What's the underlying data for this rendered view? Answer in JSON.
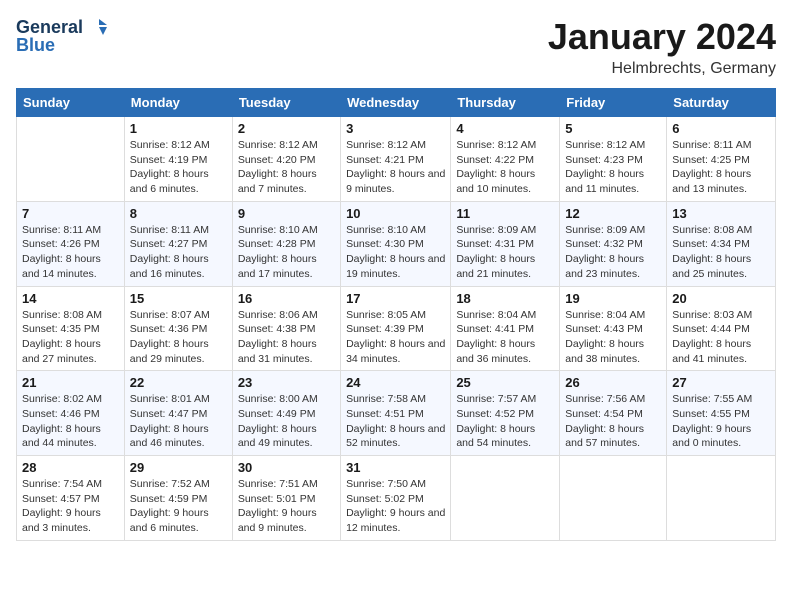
{
  "header": {
    "logo_line1": "General",
    "logo_line2": "Blue",
    "month": "January 2024",
    "location": "Helmbrechts, Germany"
  },
  "weekdays": [
    "Sunday",
    "Monday",
    "Tuesday",
    "Wednesday",
    "Thursday",
    "Friday",
    "Saturday"
  ],
  "weeks": [
    [
      {
        "day": "",
        "sunrise": "",
        "sunset": "",
        "daylight": ""
      },
      {
        "day": "1",
        "sunrise": "Sunrise: 8:12 AM",
        "sunset": "Sunset: 4:19 PM",
        "daylight": "Daylight: 8 hours and 6 minutes."
      },
      {
        "day": "2",
        "sunrise": "Sunrise: 8:12 AM",
        "sunset": "Sunset: 4:20 PM",
        "daylight": "Daylight: 8 hours and 7 minutes."
      },
      {
        "day": "3",
        "sunrise": "Sunrise: 8:12 AM",
        "sunset": "Sunset: 4:21 PM",
        "daylight": "Daylight: 8 hours and 9 minutes."
      },
      {
        "day": "4",
        "sunrise": "Sunrise: 8:12 AM",
        "sunset": "Sunset: 4:22 PM",
        "daylight": "Daylight: 8 hours and 10 minutes."
      },
      {
        "day": "5",
        "sunrise": "Sunrise: 8:12 AM",
        "sunset": "Sunset: 4:23 PM",
        "daylight": "Daylight: 8 hours and 11 minutes."
      },
      {
        "day": "6",
        "sunrise": "Sunrise: 8:11 AM",
        "sunset": "Sunset: 4:25 PM",
        "daylight": "Daylight: 8 hours and 13 minutes."
      }
    ],
    [
      {
        "day": "7",
        "sunrise": "Sunrise: 8:11 AM",
        "sunset": "Sunset: 4:26 PM",
        "daylight": "Daylight: 8 hours and 14 minutes."
      },
      {
        "day": "8",
        "sunrise": "Sunrise: 8:11 AM",
        "sunset": "Sunset: 4:27 PM",
        "daylight": "Daylight: 8 hours and 16 minutes."
      },
      {
        "day": "9",
        "sunrise": "Sunrise: 8:10 AM",
        "sunset": "Sunset: 4:28 PM",
        "daylight": "Daylight: 8 hours and 17 minutes."
      },
      {
        "day": "10",
        "sunrise": "Sunrise: 8:10 AM",
        "sunset": "Sunset: 4:30 PM",
        "daylight": "Daylight: 8 hours and 19 minutes."
      },
      {
        "day": "11",
        "sunrise": "Sunrise: 8:09 AM",
        "sunset": "Sunset: 4:31 PM",
        "daylight": "Daylight: 8 hours and 21 minutes."
      },
      {
        "day": "12",
        "sunrise": "Sunrise: 8:09 AM",
        "sunset": "Sunset: 4:32 PM",
        "daylight": "Daylight: 8 hours and 23 minutes."
      },
      {
        "day": "13",
        "sunrise": "Sunrise: 8:08 AM",
        "sunset": "Sunset: 4:34 PM",
        "daylight": "Daylight: 8 hours and 25 minutes."
      }
    ],
    [
      {
        "day": "14",
        "sunrise": "Sunrise: 8:08 AM",
        "sunset": "Sunset: 4:35 PM",
        "daylight": "Daylight: 8 hours and 27 minutes."
      },
      {
        "day": "15",
        "sunrise": "Sunrise: 8:07 AM",
        "sunset": "Sunset: 4:36 PM",
        "daylight": "Daylight: 8 hours and 29 minutes."
      },
      {
        "day": "16",
        "sunrise": "Sunrise: 8:06 AM",
        "sunset": "Sunset: 4:38 PM",
        "daylight": "Daylight: 8 hours and 31 minutes."
      },
      {
        "day": "17",
        "sunrise": "Sunrise: 8:05 AM",
        "sunset": "Sunset: 4:39 PM",
        "daylight": "Daylight: 8 hours and 34 minutes."
      },
      {
        "day": "18",
        "sunrise": "Sunrise: 8:04 AM",
        "sunset": "Sunset: 4:41 PM",
        "daylight": "Daylight: 8 hours and 36 minutes."
      },
      {
        "day": "19",
        "sunrise": "Sunrise: 8:04 AM",
        "sunset": "Sunset: 4:43 PM",
        "daylight": "Daylight: 8 hours and 38 minutes."
      },
      {
        "day": "20",
        "sunrise": "Sunrise: 8:03 AM",
        "sunset": "Sunset: 4:44 PM",
        "daylight": "Daylight: 8 hours and 41 minutes."
      }
    ],
    [
      {
        "day": "21",
        "sunrise": "Sunrise: 8:02 AM",
        "sunset": "Sunset: 4:46 PM",
        "daylight": "Daylight: 8 hours and 44 minutes."
      },
      {
        "day": "22",
        "sunrise": "Sunrise: 8:01 AM",
        "sunset": "Sunset: 4:47 PM",
        "daylight": "Daylight: 8 hours and 46 minutes."
      },
      {
        "day": "23",
        "sunrise": "Sunrise: 8:00 AM",
        "sunset": "Sunset: 4:49 PM",
        "daylight": "Daylight: 8 hours and 49 minutes."
      },
      {
        "day": "24",
        "sunrise": "Sunrise: 7:58 AM",
        "sunset": "Sunset: 4:51 PM",
        "daylight": "Daylight: 8 hours and 52 minutes."
      },
      {
        "day": "25",
        "sunrise": "Sunrise: 7:57 AM",
        "sunset": "Sunset: 4:52 PM",
        "daylight": "Daylight: 8 hours and 54 minutes."
      },
      {
        "day": "26",
        "sunrise": "Sunrise: 7:56 AM",
        "sunset": "Sunset: 4:54 PM",
        "daylight": "Daylight: 8 hours and 57 minutes."
      },
      {
        "day": "27",
        "sunrise": "Sunrise: 7:55 AM",
        "sunset": "Sunset: 4:55 PM",
        "daylight": "Daylight: 9 hours and 0 minutes."
      }
    ],
    [
      {
        "day": "28",
        "sunrise": "Sunrise: 7:54 AM",
        "sunset": "Sunset: 4:57 PM",
        "daylight": "Daylight: 9 hours and 3 minutes."
      },
      {
        "day": "29",
        "sunrise": "Sunrise: 7:52 AM",
        "sunset": "Sunset: 4:59 PM",
        "daylight": "Daylight: 9 hours and 6 minutes."
      },
      {
        "day": "30",
        "sunrise": "Sunrise: 7:51 AM",
        "sunset": "Sunset: 5:01 PM",
        "daylight": "Daylight: 9 hours and 9 minutes."
      },
      {
        "day": "31",
        "sunrise": "Sunrise: 7:50 AM",
        "sunset": "Sunset: 5:02 PM",
        "daylight": "Daylight: 9 hours and 12 minutes."
      },
      {
        "day": "",
        "sunrise": "",
        "sunset": "",
        "daylight": ""
      },
      {
        "day": "",
        "sunrise": "",
        "sunset": "",
        "daylight": ""
      },
      {
        "day": "",
        "sunrise": "",
        "sunset": "",
        "daylight": ""
      }
    ]
  ]
}
